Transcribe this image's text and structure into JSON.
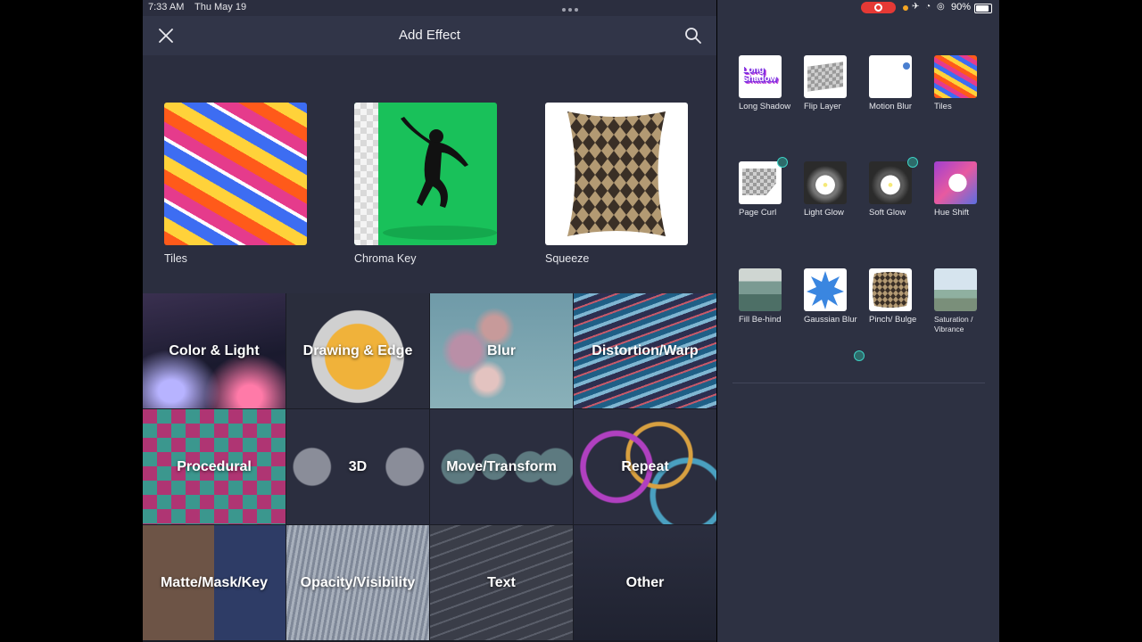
{
  "status": {
    "time": "7:33 AM",
    "date": "Thu May 19",
    "battery": "90%",
    "icons": [
      "record-icon",
      "airplane-icon",
      "wifi-icon",
      "rotation-lock-icon",
      "battery-icon"
    ]
  },
  "nav": {
    "title": "Add Effect",
    "close_icon": "close-icon",
    "search_icon": "search-icon"
  },
  "featured": [
    {
      "label": "Tiles"
    },
    {
      "label": "Chroma Key"
    },
    {
      "label": "Squeeze"
    }
  ],
  "categories": [
    {
      "label": "Color & Light"
    },
    {
      "label": "Drawing & Edge"
    },
    {
      "label": "Blur"
    },
    {
      "label": "Distortion/Warp"
    },
    {
      "label": "Procedural"
    },
    {
      "label": "3D"
    },
    {
      "label": "Move/Transform"
    },
    {
      "label": "Repeat"
    },
    {
      "label": "Matte/Mask/Key"
    },
    {
      "label": "Opacity/Visibility"
    },
    {
      "label": "Text"
    },
    {
      "label": "Other"
    }
  ],
  "recent": [
    {
      "label": "Long Shadow",
      "thumb_text": "Long Shadow"
    },
    {
      "label": "Flip Layer"
    },
    {
      "label": "Motion Blur"
    },
    {
      "label": "Tiles"
    },
    {
      "label": "Page Curl"
    },
    {
      "label": "Light Glow"
    },
    {
      "label": "Soft Glow"
    },
    {
      "label": "Hue Shift"
    },
    {
      "label": "Fill Be-hind"
    },
    {
      "label": "Gaussian Blur"
    },
    {
      "label": "Pinch/ Bulge"
    },
    {
      "label": "Saturation / Vibrance"
    }
  ],
  "colors": {
    "panel": "#2b2e3f",
    "right_panel": "#2d3142",
    "accent_teal": "#3dd1c4",
    "record_red": "#e53935",
    "chroma_green": "#19c15a"
  }
}
